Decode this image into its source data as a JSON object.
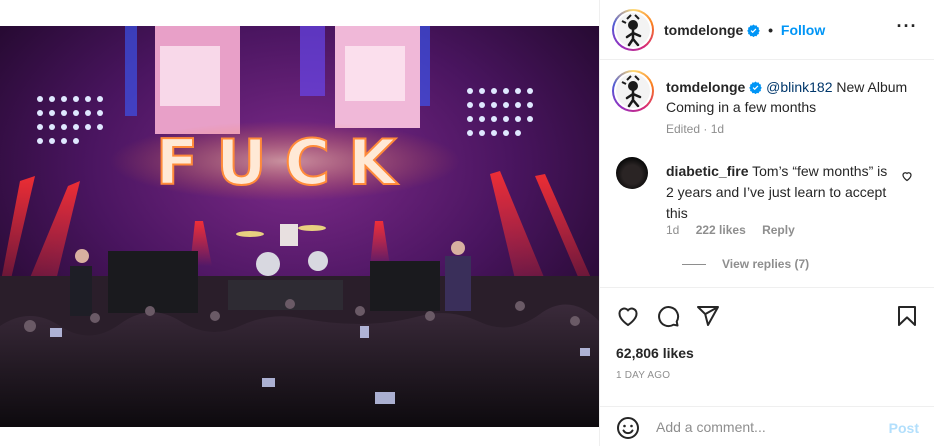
{
  "post": {
    "author": "tomdelonge",
    "follow_label": "Follow",
    "separator": "•",
    "more_label": "···",
    "image_alt": "Concert stage with band performing and illuminated sign",
    "stage_sign": "FUCK"
  },
  "caption": {
    "author": "tomdelonge",
    "mention": "@blink182",
    "text": " New Album Coming in a few months",
    "meta": "Edited · 1d"
  },
  "comment": {
    "author": "diabetic_fire",
    "text": "Tom’s “few months” is 2 years and I’ve just learn to accept this",
    "time": "1d",
    "likes": "222 likes",
    "reply_label": "Reply",
    "view_replies": "View replies (7)"
  },
  "actions": {
    "likes": "62,806 likes",
    "time_ago": "1 DAY AGO",
    "comment_placeholder": "Add a comment...",
    "post_label": "Post"
  },
  "colors": {
    "accent": "#0095f6",
    "mention": "#00376b",
    "muted": "#8e8e8e",
    "post_disabled": "#b2dffc"
  },
  "icons": [
    "verified-badge-icon",
    "more-options-icon",
    "heart-icon",
    "comment-icon",
    "share-icon",
    "bookmark-icon",
    "emoji-icon"
  ]
}
